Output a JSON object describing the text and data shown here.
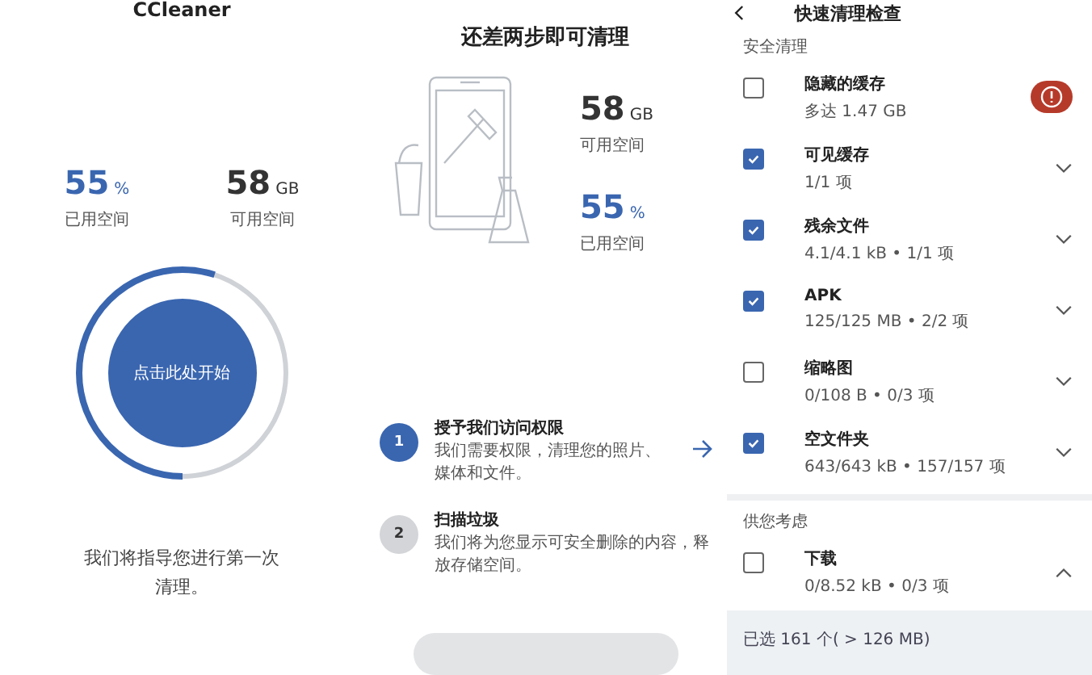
{
  "panel_start": {
    "app_title": "CCleaner",
    "stats": [
      {
        "kind": "used",
        "value": "55",
        "unit": "%",
        "label": "已用空间"
      },
      {
        "kind": "free",
        "value": "58",
        "unit": "GB",
        "label": "可用空间"
      }
    ],
    "ring": {
      "level": 0.55,
      "button": "点击此处开始"
    },
    "message": "我们将指导您进行第一次清理。"
  },
  "panel_steps": {
    "title": "还差两步即可清理",
    "stats": [
      {
        "kind": "free",
        "value": "58",
        "unit": "GB",
        "label": "可用空间"
      },
      {
        "kind": "used",
        "value": "55",
        "unit": "%",
        "label": "已用空间"
      }
    ],
    "steps": [
      {
        "number": "1",
        "title": "授予我们访问权限",
        "text": "我们需要权限，清理您的照片、媒体和文件。",
        "selected": true
      },
      {
        "number": "2",
        "title": "扫描垃圾",
        "text": "我们将为您显示可安全删除的内容，释放存储空间。",
        "selected": false
      }
    ]
  },
  "panel_review": {
    "title": "快速清理检查",
    "sections": [
      {
        "label": "安全清理",
        "items": [
          {
            "name": "隐藏的缓存",
            "detail": "多达 1.47 GB",
            "checked": false,
            "kind": "warning"
          },
          {
            "name": "可见缓存",
            "detail": "1/1 项",
            "checked": true,
            "kind": "collapsed"
          },
          {
            "name": "残余文件",
            "detail": "4.1/4.1 kB • 1/1 项",
            "checked": true,
            "kind": "collapsed"
          },
          {
            "name": "APK",
            "detail": "125/125 MB • 2/2 项",
            "checked": true,
            "kind": "collapsed"
          },
          {
            "name": "缩略图",
            "detail": "0/108 B • 0/3 项",
            "checked": false,
            "kind": "collapsed"
          },
          {
            "name": "空文件夹",
            "detail": "643/643 kB • 157/157 项",
            "checked": true,
            "kind": "collapsed"
          }
        ]
      },
      {
        "label": "供您考虑",
        "items": [
          {
            "name": "下载",
            "detail": "0/8.52 kB • 0/3 项",
            "checked": false,
            "kind": "expanded"
          }
        ]
      }
    ],
    "footer": "已选 161 个( > 126 MB)"
  }
}
